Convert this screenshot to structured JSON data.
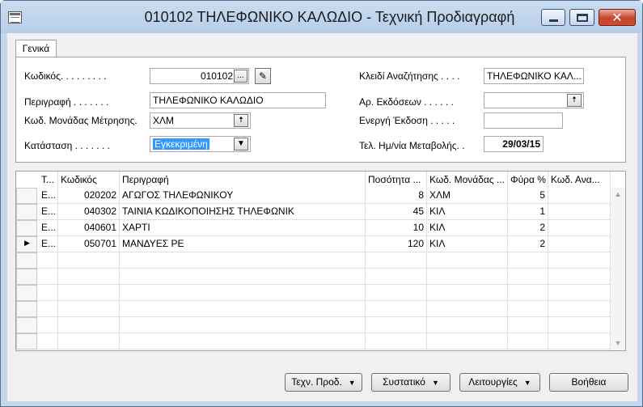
{
  "window": {
    "title": "010102 ΤΗΛΕΦΩΝΙΚΟ ΚΑΛΩΔΙΟ - Τεχνική Προδιαγραφή"
  },
  "tab": {
    "label": "Γενικά"
  },
  "form": {
    "code_label": "Κωδικός. . . . . . . . .",
    "code_value": "010102",
    "description_label": "Περιγραφή . . . . . . .",
    "description_value": "ΤΗΛΕΦΩΝΙΚΟ ΚΑΛΩΔΙΟ",
    "unit_label": "Κωδ. Μονάδας Μέτρησης.",
    "unit_value": "ΧΛΜ",
    "status_label": "Κατάσταση . . . . . . .",
    "status_value": "Εγκεκριμένη",
    "search_key_label": "Κλειδί Αναζήτησης . . . .",
    "search_key_value": "ΤΗΛΕΦΩΝΙΚΟ ΚΑΛ...",
    "versions_label": "Αρ. Εκδόσεων . . . . . .",
    "versions_value": "",
    "active_version_label": "Ενεργή Έκδοση . . . . .",
    "active_version_value": "",
    "last_modified_label": "Τελ. Ημ/νία Μεταβολής. .",
    "last_modified_value": "29/03/15"
  },
  "grid": {
    "columns": [
      "Τ...",
      "Κωδικός",
      "Περιγραφή",
      "Ποσότητα ...",
      "Κωδ. Μονάδας ...",
      "Φύρα %",
      "Κωδ. Ανα..."
    ],
    "rows": [
      {
        "type": "Ε...",
        "code": "020202",
        "description": "ΑΓΩΓΟΣ ΤΗΛΕΦΩΝΙΚΟΥ",
        "quantity": "8",
        "unit": "ΧΛΜ",
        "scrap": "5",
        "alt": ""
      },
      {
        "type": "Ε...",
        "code": "040302",
        "description": "ΤΑΙΝΙΑ ΚΩΔΙΚΟΠΟΙΗΣΗΣ ΤΗΛΕΦΩΝΙΚ",
        "quantity": "45",
        "unit": "ΚΙΛ",
        "scrap": "1",
        "alt": ""
      },
      {
        "type": "Ε...",
        "code": "040601",
        "description": "ΧΑΡΤΙ",
        "quantity": "10",
        "unit": "ΚΙΛ",
        "scrap": "2",
        "alt": ""
      },
      {
        "type": "Ε...",
        "code": "050701",
        "description": "ΜΑΝΔΥΕΣ ΡΕ",
        "quantity": "120",
        "unit": "ΚΙΛ",
        "scrap": "2",
        "alt": ""
      }
    ],
    "selected_row_marker": "▶"
  },
  "buttons": {
    "tech_spec": "Τεχν. Προδ.",
    "component": "Συστατικό",
    "functions": "Λειτουργίες",
    "help": "Βοήθεια"
  }
}
